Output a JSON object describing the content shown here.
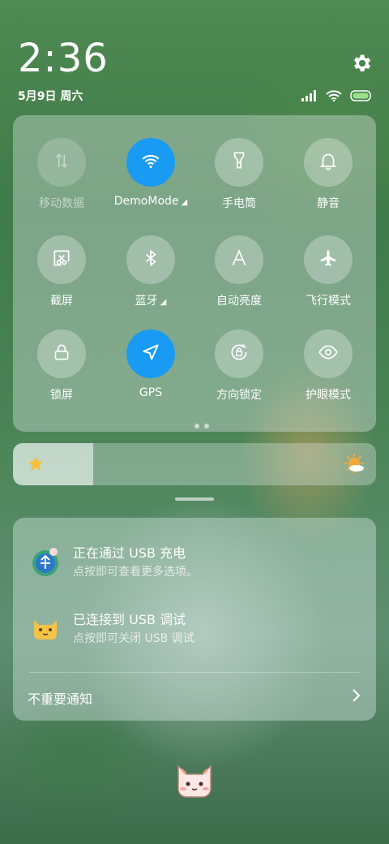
{
  "status_bar": {
    "time": "2:36",
    "date": "5月9日 周六",
    "icons": [
      "signal-icon",
      "wifi-icon",
      "battery-icon"
    ],
    "settings_icon": "gear-icon"
  },
  "quick_settings": {
    "tiles": [
      {
        "label": "移动数据",
        "icon": "mobile-data-icon",
        "state": "disabled"
      },
      {
        "label": "DemoMode",
        "caret": "◢",
        "icon": "wifi-icon",
        "state": "on"
      },
      {
        "label": "手电筒",
        "icon": "flashlight-icon",
        "state": "off"
      },
      {
        "label": "静音",
        "icon": "bell-icon",
        "state": "off"
      },
      {
        "label": "截屏",
        "icon": "screenshot-icon",
        "state": "off"
      },
      {
        "label": "蓝牙",
        "caret": "◢",
        "icon": "bluetooth-icon",
        "state": "off"
      },
      {
        "label": "自动亮度",
        "icon": "auto-brightness-icon",
        "state": "off"
      },
      {
        "label": "飞行模式",
        "icon": "airplane-icon",
        "state": "off"
      },
      {
        "label": "锁屏",
        "icon": "lock-icon",
        "state": "off"
      },
      {
        "label": "GPS",
        "icon": "location-icon",
        "state": "on"
      },
      {
        "label": "方向锁定",
        "icon": "rotation-lock-icon",
        "state": "off"
      },
      {
        "label": "护眼模式",
        "icon": "eye-icon",
        "state": "off"
      }
    ],
    "accent_color": "#1a9bf3"
  },
  "brightness": {
    "level": 0.22
  },
  "notifications": {
    "items": [
      {
        "title": "正在通过 USB 充电",
        "subtitle": "点按即可查看更多选项。",
        "icon": "usb-charging-icon"
      },
      {
        "title": "已连接到 USB 调试",
        "subtitle": "点按即可关闭 USB 调试",
        "icon": "cat-face-icon"
      }
    ],
    "footer": "不重要通知"
  }
}
